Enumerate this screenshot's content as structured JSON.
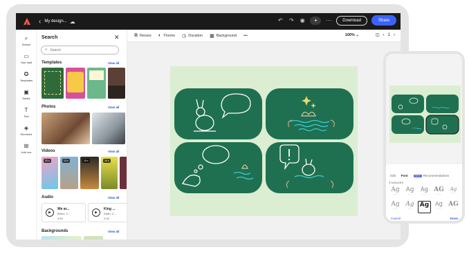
{
  "header": {
    "title": "My design...",
    "download_label": "Download",
    "share_label": "Share"
  },
  "rail": {
    "items": [
      {
        "label": "Search",
        "icon": "search-icon"
      },
      {
        "label": "Your stuff",
        "icon": "folder-icon"
      },
      {
        "label": "Templates",
        "icon": "templates-icon"
      },
      {
        "label": "Media",
        "icon": "media-icon"
      },
      {
        "label": "Text",
        "icon": "text-icon"
      },
      {
        "label": "Elements",
        "icon": "elements-icon"
      },
      {
        "label": "Add ons",
        "icon": "addons-icon"
      }
    ]
  },
  "panel": {
    "title": "Search",
    "search_placeholder": "Search",
    "view_all": "View all",
    "templates_title": "Templates",
    "photos_title": "Photos",
    "videos_title": "Videos",
    "audio_title": "Audio",
    "backgrounds_title": "Backgrounds",
    "videos": [
      {
        "duration": "20 s"
      },
      {
        "duration": "13 s"
      },
      {
        "duration": "15 s"
      },
      {
        "duration": "16 s"
      }
    ],
    "audio": [
      {
        "title": "We ar...",
        "artist": "Bravo, C...",
        "duration": "4:20"
      },
      {
        "title": "King ...",
        "artist": "Earth, C...",
        "duration": "2:15"
      }
    ]
  },
  "toolbar": {
    "resize": "Resize",
    "theme": "Theme",
    "duration": "Duration",
    "background": "Background",
    "more": "•••",
    "zoom": "100%",
    "page": "1"
  },
  "phone": {
    "tab_edit": "Edit",
    "tab_font": "Font",
    "tab_new": "NEW",
    "tab_recommendations": "Recommendations",
    "section": "STANDARD",
    "cancel": "Cancel",
    "done": "Done"
  },
  "colors": {
    "accent": "#3b63fb",
    "card_green": "#1f7050",
    "artboard": "#dbeed2",
    "topbar": "#1a1a1a"
  }
}
